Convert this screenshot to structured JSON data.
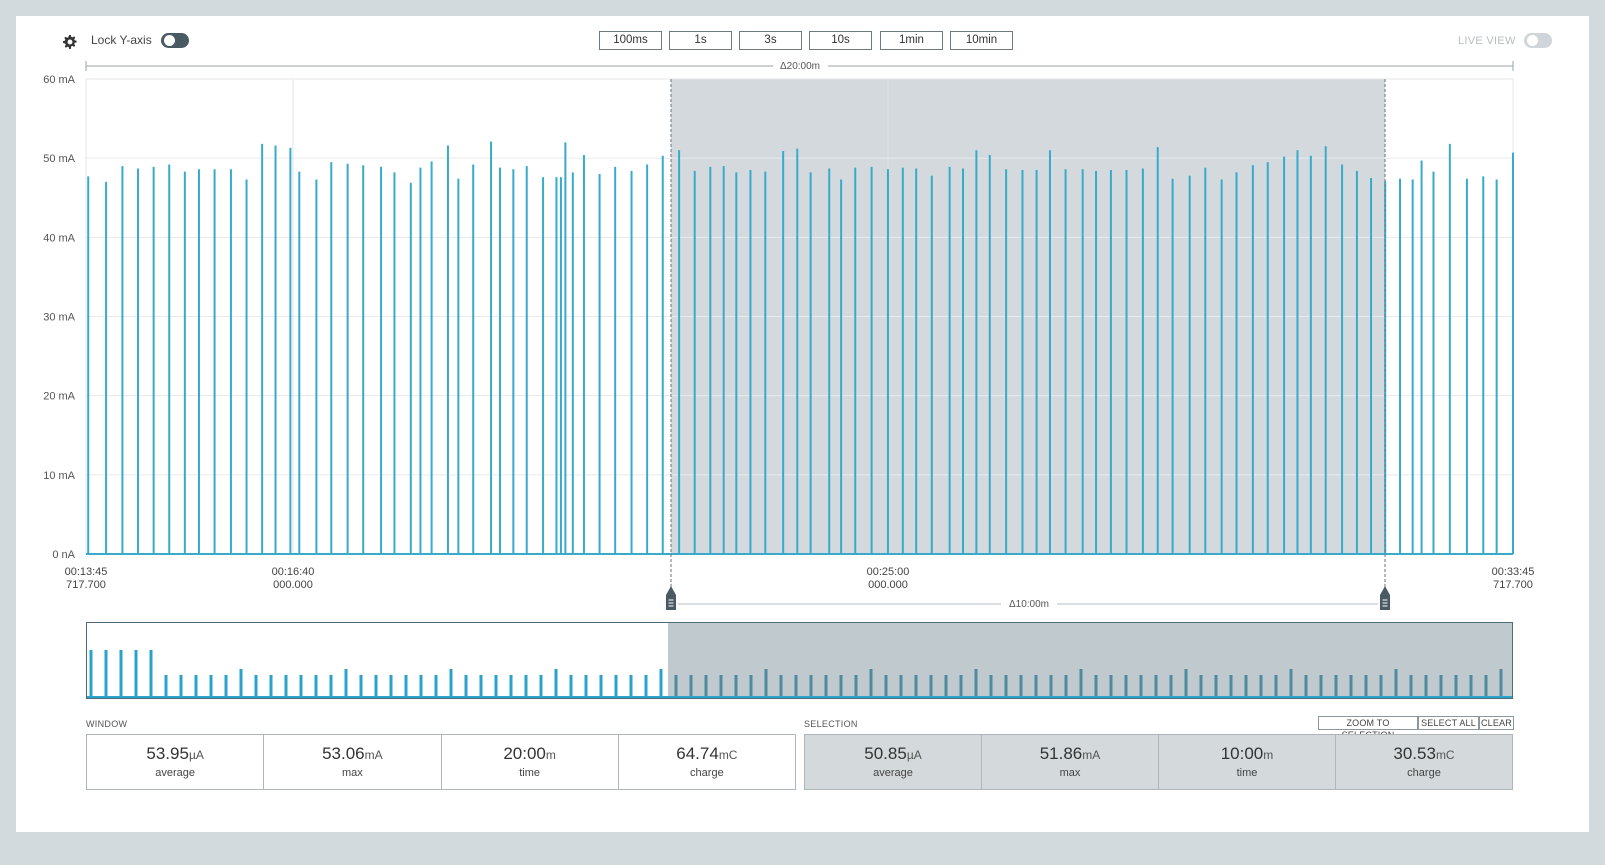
{
  "toolbar": {
    "gear_icon": "gear-icon",
    "lock_label": "Lock Y-axis",
    "lock_on": true,
    "zoom_buttons": [
      "100ms",
      "1s",
      "3s",
      "10s",
      "1min",
      "10min"
    ],
    "live_label": "LIVE VIEW",
    "live_on": false
  },
  "chart": {
    "window_delta": "Δ20:00m",
    "selection_delta": "Δ10:00m",
    "x_start": {
      "time": "00:13:45",
      "ms": "717.700"
    },
    "x_mid1": {
      "time": "00:16:40",
      "ms": "000.000"
    },
    "x_mid2": {
      "time": "00:25:00",
      "ms": "000.000"
    },
    "x_end": {
      "time": "00:33:45",
      "ms": "717.700"
    },
    "colors": {
      "trace": "#38aacb",
      "selection": "#d3d9dc",
      "minimap_trace": "#2aa3cc",
      "minimap_sel_trace": "#4f8aa0"
    }
  },
  "chart_data": {
    "type": "line",
    "title": "",
    "xlabel": "",
    "ylabel": "",
    "y_ticks": [
      "60 mA",
      "50 mA",
      "40 mA",
      "30 mA",
      "20 mA",
      "10 mA",
      "0 nA"
    ],
    "ylim": [
      0,
      60
    ],
    "xlim": [
      "00:13:45.717700",
      "00:33:45.717700"
    ],
    "selection": [
      "00:23:45.717700",
      "00:33:45.717700"
    ],
    "series": [
      {
        "x_seconds_from_start": [
          3,
          27,
          49,
          70,
          91,
          112,
          133,
          152,
          173,
          195,
          216,
          237,
          255,
          275,
          287,
          310,
          330,
          352,
          373,
          397,
          415,
          437,
          450,
          465,
          487,
          501,
          521,
          545,
          557,
          575,
          593,
          615,
          633,
          639,
          645,
          655,
          670,
          691,
          712,
          734,
          755,
          776,
          798,
          819,
          840,
          858,
          875,
          894,
          914,
          938,
          957,
          975,
          1000,
          1016,
          1035,
          1057,
          1079,
          1099,
          1117,
          1138,
          1162,
          1180,
          1198,
          1216,
          1238,
          1260,
          1279,
          1297,
          1318,
          1341,
          1359,
          1379,
          1400,
          1422,
          1442,
          1462,
          1485,
          1506,
          1528,
          1548,
          1570,
          1590,
          1612,
          1630,
          1648,
          1668,
          1690,
          1710,
          1729,
          1748,
          1768,
          1785,
          1797,
          1813,
          1835,
          1858,
          1880,
          1898,
          1920
        ],
        "y_mA": [
          47.7,
          47.0,
          49.0,
          48.7,
          48.9,
          49.2,
          48.3,
          48.6,
          48.6,
          48.6,
          47.3,
          51.8,
          51.6,
          51.3,
          48.3,
          47.3,
          49.5,
          49.3,
          49.1,
          48.9,
          48.2,
          46.9,
          48.8,
          49.6,
          51.6,
          47.4,
          49.2,
          52.1,
          48.8,
          48.6,
          49.0,
          47.6,
          47.6,
          47.6,
          52.0,
          48.2,
          50.4,
          48.0,
          48.9,
          48.4,
          49.2,
          50.3,
          51.0,
          48.4,
          48.9,
          49.0,
          48.2,
          48.5,
          48.3,
          50.9,
          51.2,
          48.2,
          48.7,
          47.3,
          48.8,
          48.9,
          48.6,
          48.8,
          48.7,
          47.8,
          48.9,
          48.7,
          51.0,
          50.4,
          48.6,
          48.5,
          48.5,
          51.0,
          48.6,
          48.6,
          48.4,
          48.5,
          48.5,
          48.7,
          51.4,
          47.4,
          47.8,
          48.8,
          47.3,
          48.2,
          49.1,
          49.5,
          50.2,
          51.0,
          50.3,
          51.5,
          49.2,
          48.4,
          47.5,
          47.1,
          47.4,
          47.3,
          49.7,
          48.3,
          51.8,
          47.4,
          47.7,
          47.3,
          50.7
        ]
      }
    ]
  },
  "window": {
    "heading": "WINDOW",
    "stats": [
      {
        "value": "53.95",
        "unit": "µA",
        "label": "average"
      },
      {
        "value": "53.06",
        "unit": "mA",
        "label": "max"
      },
      {
        "value": "20:00",
        "unit": "m",
        "label": "time"
      },
      {
        "value": "64.74",
        "unit": "mC",
        "label": "charge"
      }
    ]
  },
  "selection": {
    "heading": "SELECTION",
    "buttons": [
      "ZOOM TO SELECTION",
      "SELECT ALL",
      "CLEAR"
    ],
    "stats": [
      {
        "value": "50.85",
        "unit": "µA",
        "label": "average"
      },
      {
        "value": "51.86",
        "unit": "mA",
        "label": "max"
      },
      {
        "value": "10:00",
        "unit": "m",
        "label": "time"
      },
      {
        "value": "30.53",
        "unit": "mC",
        "label": "charge"
      }
    ]
  }
}
